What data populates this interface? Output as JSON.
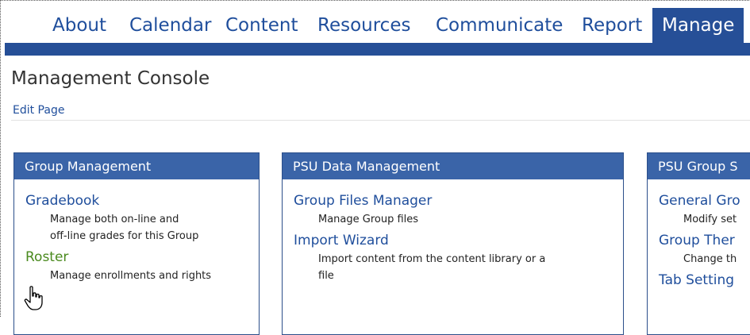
{
  "nav": {
    "items": [
      "About",
      "Calendar",
      "Content",
      "Resources",
      "Communicate",
      "Report",
      "Manage"
    ],
    "active": "Manage"
  },
  "page": {
    "title": "Management Console",
    "edit_link": "Edit Page"
  },
  "panels": [
    {
      "title": "Group Management",
      "items": [
        {
          "label": "Gradebook",
          "desc_lines": [
            "Manage both on-line and",
            "off-line grades for this Group"
          ]
        },
        {
          "label": "Roster",
          "desc_lines": [
            "Manage enrollments and rights"
          ]
        }
      ]
    },
    {
      "title": "PSU Data Management",
      "items": [
        {
          "label": "Group Files Manager",
          "desc_lines": [
            "Manage Group files"
          ]
        },
        {
          "label": "Import Wizard",
          "desc_lines": [
            "Import content from the content library or a",
            "file"
          ]
        }
      ]
    },
    {
      "title": "PSU Group S",
      "items": [
        {
          "label": "General Gro",
          "desc_lines": [
            "Modify set"
          ]
        },
        {
          "label": "Group Ther",
          "desc_lines": [
            "Change th"
          ]
        },
        {
          "label": "Tab Setting",
          "desc_lines": []
        }
      ]
    }
  ],
  "colors": {
    "nav_bar": "#264f97",
    "panel_header": "#3a64a8",
    "link": "#1f4e9c",
    "hover_link": "#4a8a1e"
  },
  "icons": {
    "cursor": "hand-pointer-icon"
  }
}
